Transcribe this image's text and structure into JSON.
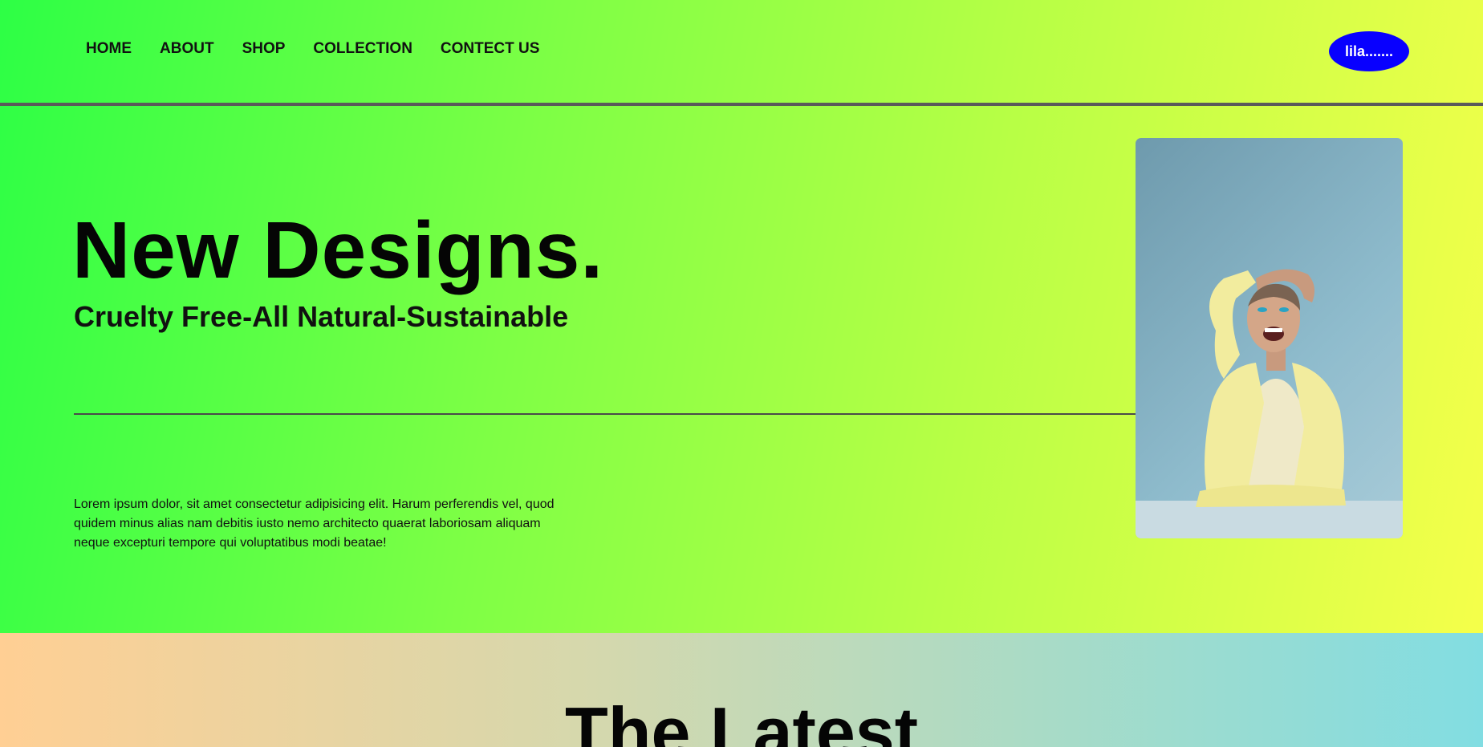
{
  "nav": {
    "items": [
      {
        "label": "HOME"
      },
      {
        "label": "ABOUT"
      },
      {
        "label": "SHOP"
      },
      {
        "label": "COLLECTION"
      },
      {
        "label": "CONTECT US"
      }
    ],
    "brand_button": "lila......."
  },
  "hero": {
    "title": "New Designs.",
    "subtitle": "Cruelty Free-All Natural-Sustainable",
    "paragraph": "Lorem ipsum dolor, sit amet consectetur adipisicing elit. Harum perferendis vel, quod quidem minus alias nam debitis iusto nemo architecto quaerat laboriosam aliquam neque excepturi tempore qui voluptatibus modi beatae!"
  },
  "latest": {
    "title": "The Latest"
  },
  "colors": {
    "brand_button": "#0800ff",
    "hero_gradient_start": "#2dff45",
    "hero_gradient_end": "#f5ff4a",
    "latest_gradient_start": "#ffcf94",
    "latest_gradient_end": "#82dde2"
  }
}
